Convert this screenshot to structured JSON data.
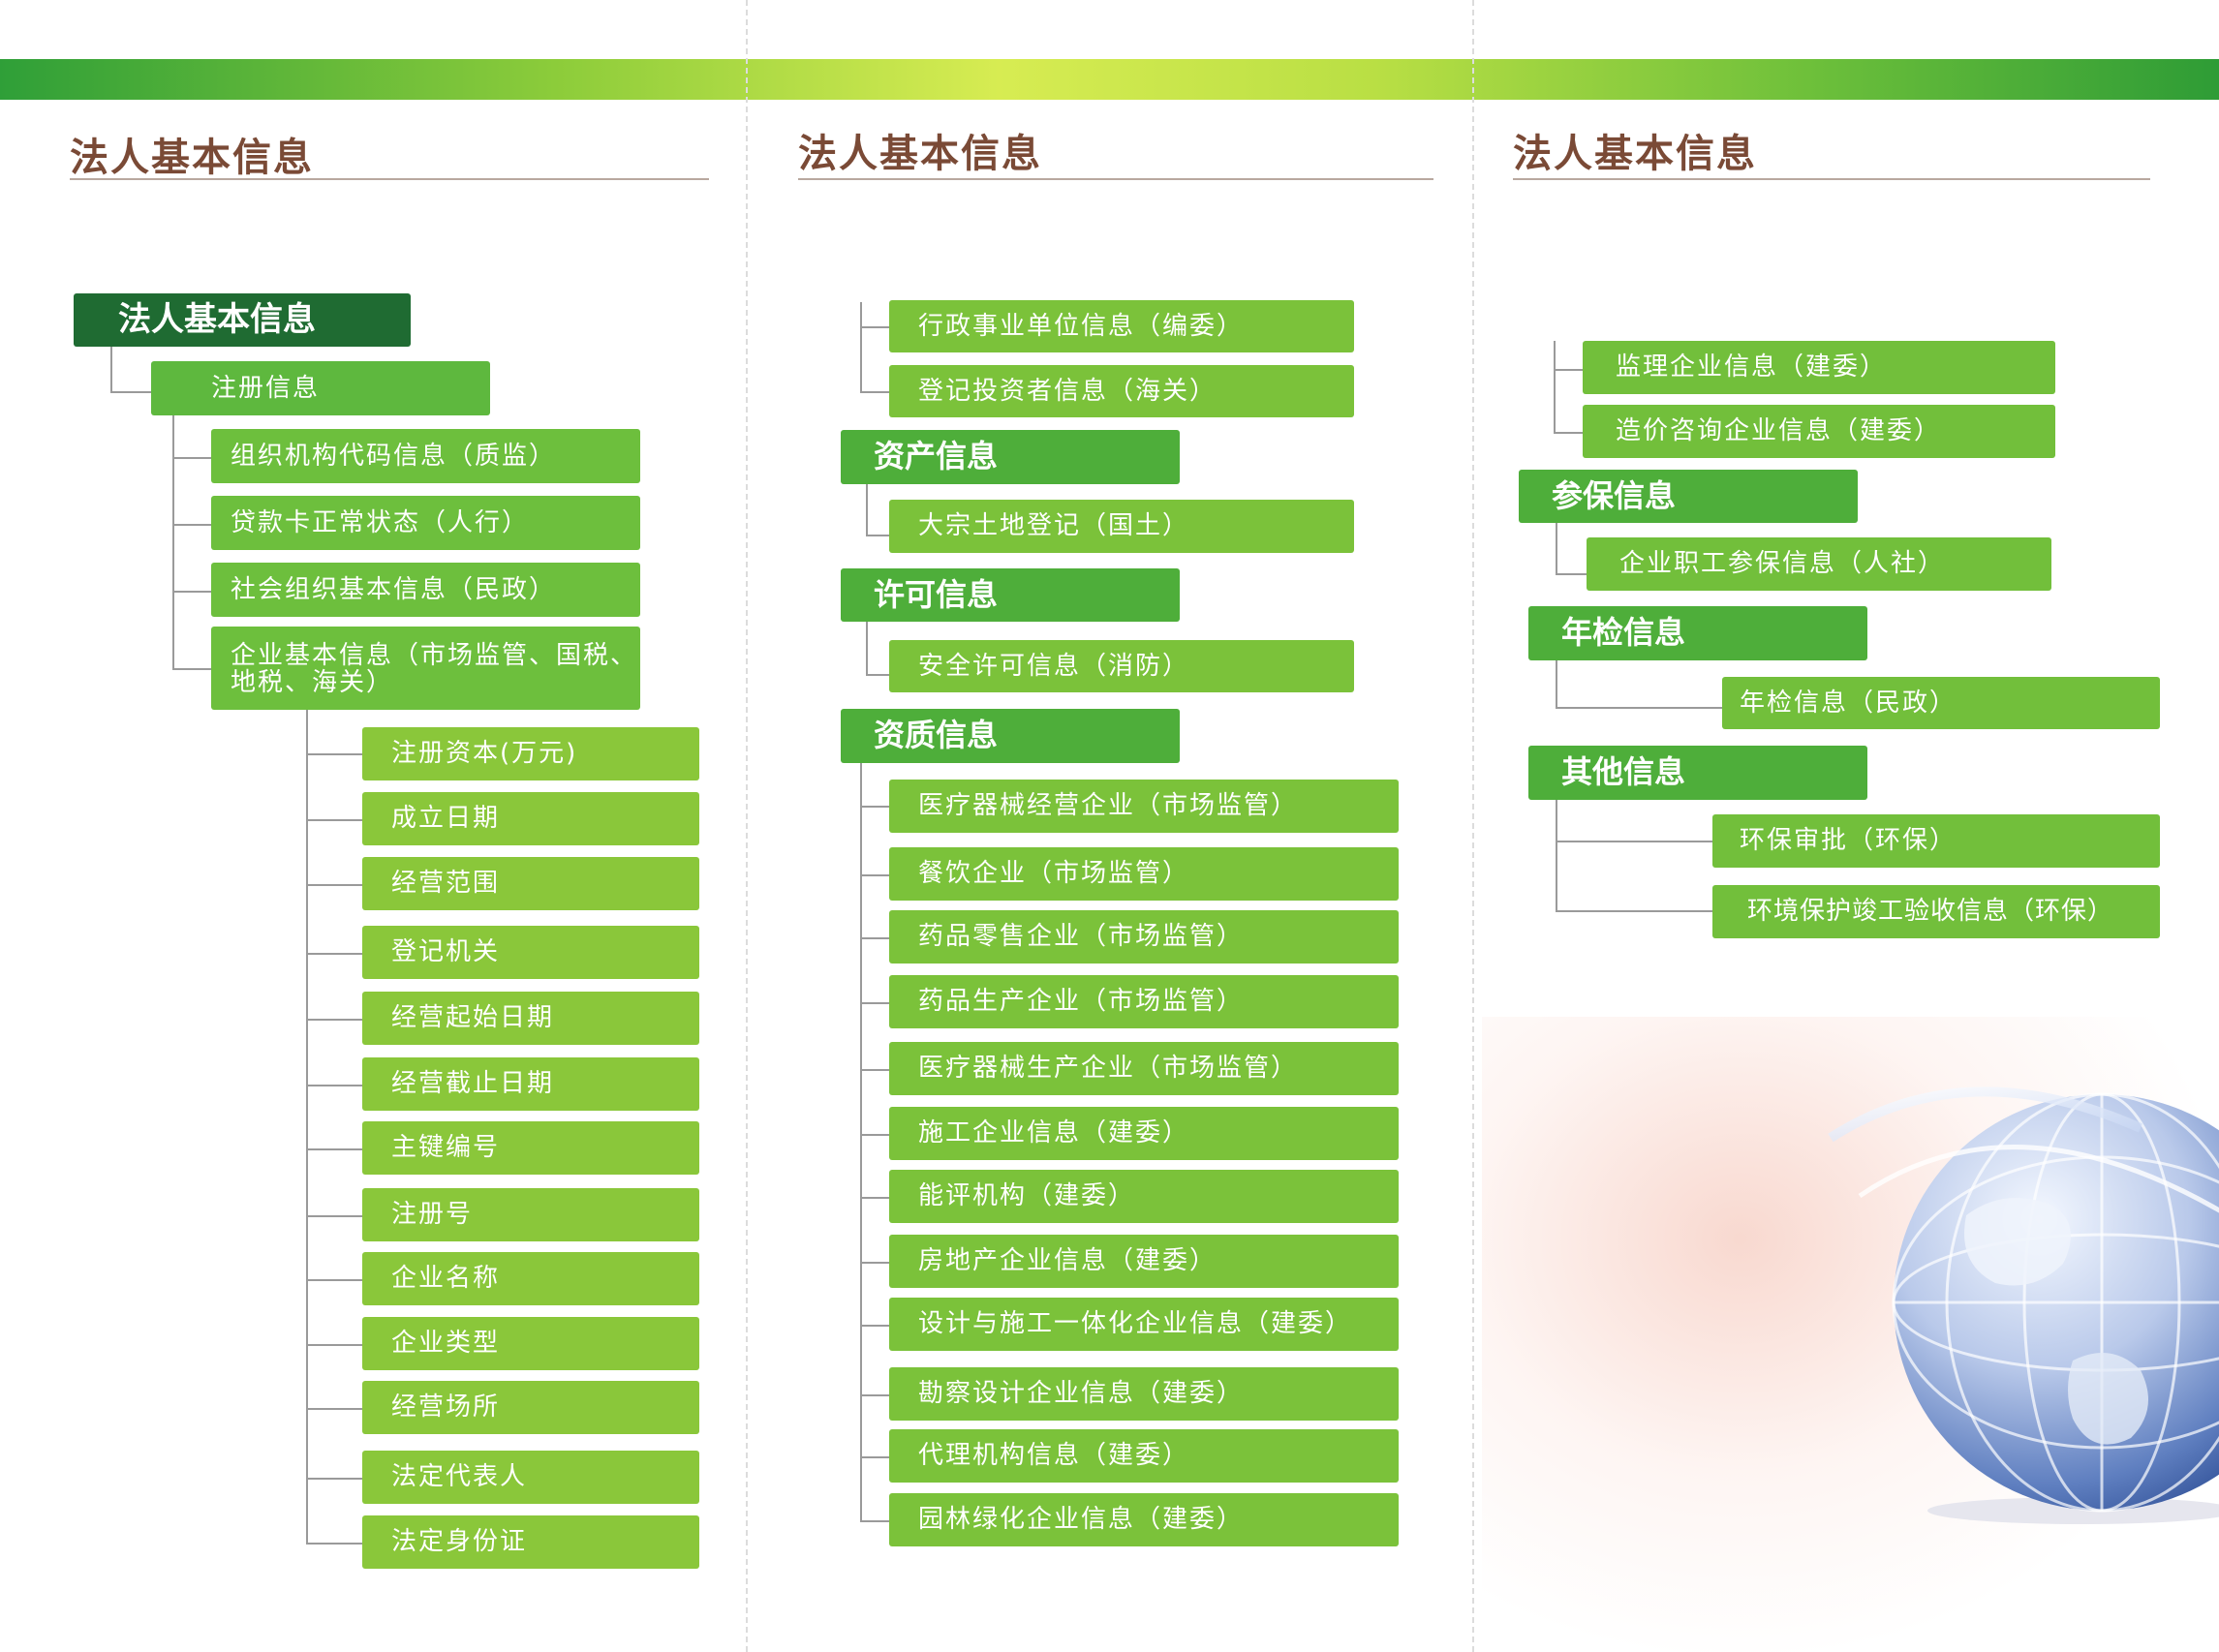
{
  "panels": [
    {
      "title": "法人基本信息"
    },
    {
      "title": "法人基本信息"
    },
    {
      "title": "法人基本信息"
    }
  ],
  "left": {
    "root": "法人基本信息",
    "registration": "注册信息",
    "sources": [
      "组织机构代码信息（质监）",
      "贷款卡正常状态（人行）",
      "社会组织基本信息（民政）",
      "企业基本信息（市场监管、国税、地税、海关）"
    ],
    "fields": [
      "注册资本(万元)",
      "成立日期",
      "经营范围",
      "登记机关",
      "经营起始日期",
      "经营截止日期",
      "主键编号",
      "注册号",
      "企业名称",
      "企业类型",
      "经营场所",
      "法定代表人",
      "法定身份证"
    ]
  },
  "middle": {
    "top_items": [
      "行政事业单位信息（编委）",
      "登记投资者信息（海关）"
    ],
    "assets": {
      "title": "资产信息",
      "items": [
        "大宗土地登记（国土）"
      ]
    },
    "license": {
      "title": "许可信息",
      "items": [
        "安全许可信息（消防）"
      ]
    },
    "qualification": {
      "title": "资质信息",
      "items": [
        "医疗器械经营企业（市场监管）",
        "餐饮企业（市场监管）",
        "药品零售企业（市场监管）",
        "药品生产企业（市场监管）",
        "医疗器械生产企业（市场监管）",
        "施工企业信息（建委）",
        "能评机构（建委）",
        "房地产企业信息（建委）",
        "设计与施工一体化企业信息（建委）",
        "勘察设计企业信息（建委）",
        "代理机构信息（建委）",
        "园林绿化企业信息（建委）"
      ]
    }
  },
  "right": {
    "top_items": [
      "监理企业信息（建委）",
      "造价咨询企业信息（建委）"
    ],
    "insurance": {
      "title": "参保信息",
      "items": [
        "企业职工参保信息（人社）"
      ]
    },
    "inspection": {
      "title": "年检信息",
      "items": [
        "年检信息（民政）"
      ]
    },
    "other": {
      "title": "其他信息",
      "items": [
        "环保审批（环保）",
        "环境保护竣工验收信息（环保）"
      ]
    }
  },
  "colors": {
    "band_dark": "#2f9f38",
    "band_light": "#d7ec52",
    "title_brown": "#7a4a36",
    "root_dark_green": "#1f6b32",
    "node_green": "#5eb83e",
    "leaf_lime": "#8ac73a"
  }
}
